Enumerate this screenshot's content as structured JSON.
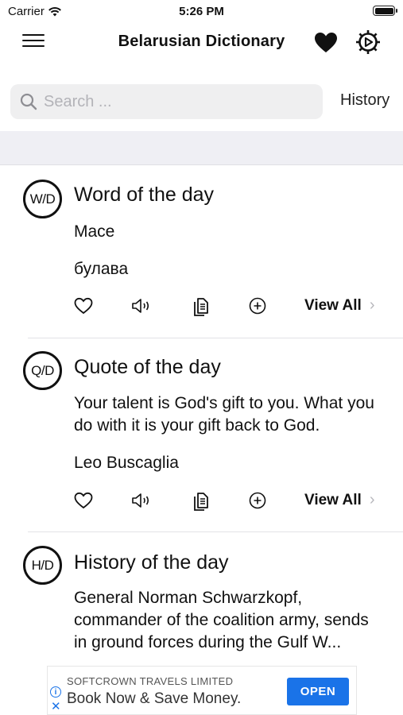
{
  "status": {
    "carrier": "Carrier",
    "time": "5:26 PM"
  },
  "nav": {
    "title": "Belarusian Dictionary"
  },
  "search": {
    "placeholder": "Search ...",
    "history_label": "History"
  },
  "cards": [
    {
      "badge": "W/D",
      "title": "Word of the day",
      "line1": "Mace",
      "line2": "булава",
      "view_all": "View All"
    },
    {
      "badge": "Q/D",
      "title": "Quote of the day",
      "line1": "Your talent is God's gift to you. What you do with it is your gift back to God.",
      "line2": "Leo Buscaglia",
      "view_all": "View All"
    },
    {
      "badge": "H/D",
      "title": "History of the day",
      "line1": "General Norman Schwarzkopf, commander of the coalition army, sends in ground forces during the Gulf W..."
    }
  ],
  "ad": {
    "company": "SOFTCROWN TRAVELS LIMITED",
    "headline": "Book Now & Save Money.",
    "cta": "OPEN"
  },
  "colors": {
    "accent": "#1a73e8",
    "band": "#efeff4",
    "search_bg": "#efeff0"
  },
  "icons": [
    "hamburger-menu-icon",
    "heart-icon",
    "settings-gear-icon",
    "search-icon",
    "heart-outline-icon",
    "speaker-icon",
    "copy-icon",
    "plus-circle-icon",
    "chevron-right-icon",
    "info-icon",
    "close-icon"
  ]
}
